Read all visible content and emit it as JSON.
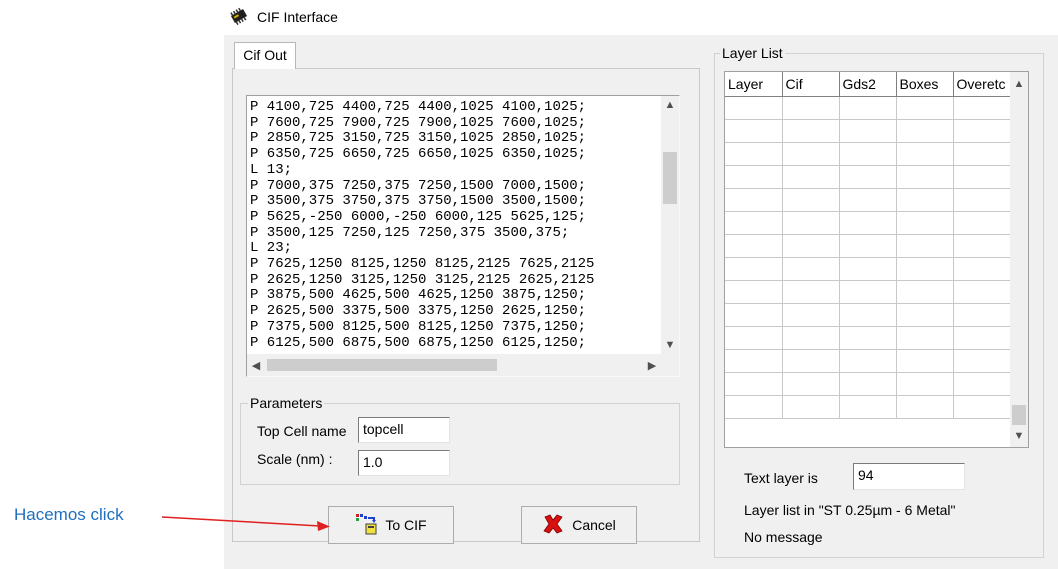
{
  "window": {
    "title": "CIF Interface",
    "icon": "chip-icon"
  },
  "tab": {
    "label": "Cif Out"
  },
  "cif_output": {
    "lines": [
      "P 4100,725 4400,725 4400,1025 4100,1025;",
      "P 7600,725 7900,725 7900,1025 7600,1025;",
      "P 2850,725 3150,725 3150,1025 2850,1025;",
      "P 6350,725 6650,725 6650,1025 6350,1025;",
      "L 13;",
      "P 7000,375 7250,375 7250,1500 7000,1500;",
      "P 3500,375 3750,375 3750,1500 3500,1500;",
      "P 5625,-250 6000,-250 6000,125 5625,125;",
      "P 3500,125 7250,125 7250,375 3500,375;",
      "L 23;",
      "P 7625,1250 8125,1250 8125,2125 7625,2125",
      "P 2625,1250 3125,1250 3125,2125 2625,2125",
      "P 3875,500 4625,500 4625,1250 3875,1250;",
      "P 2625,500 3375,500 3375,1250 2625,1250;",
      "P 7375,500 8125,500 8125,1250 7375,1250;",
      "P 6125,500 6875,500 6875,1250 6125,1250;"
    ]
  },
  "parameters": {
    "group_label": "Parameters",
    "top_cell_label": "Top Cell name",
    "top_cell_value": "topcell",
    "scale_label": "Scale (nm) :",
    "scale_value": "1.0"
  },
  "buttons": {
    "to_cif": "To CIF",
    "cancel": "Cancel"
  },
  "layer_list": {
    "group_label": "Layer List",
    "columns": [
      "Layer",
      "Cif",
      "Gds2",
      "Boxes",
      "Overetc"
    ],
    "empty_rows": 14
  },
  "status": {
    "text_layer_label": "Text layer is",
    "text_layer_value": "94",
    "layer_list_info": "Layer list in \"ST 0.25µm - 6 Metal\"",
    "message": "No message"
  },
  "annotation": {
    "text": "Hacemos click",
    "arrow_color": "#e02020"
  },
  "colors": {
    "annotation_text": "#1f6fbf",
    "window_bg": "#f0f0f0"
  }
}
